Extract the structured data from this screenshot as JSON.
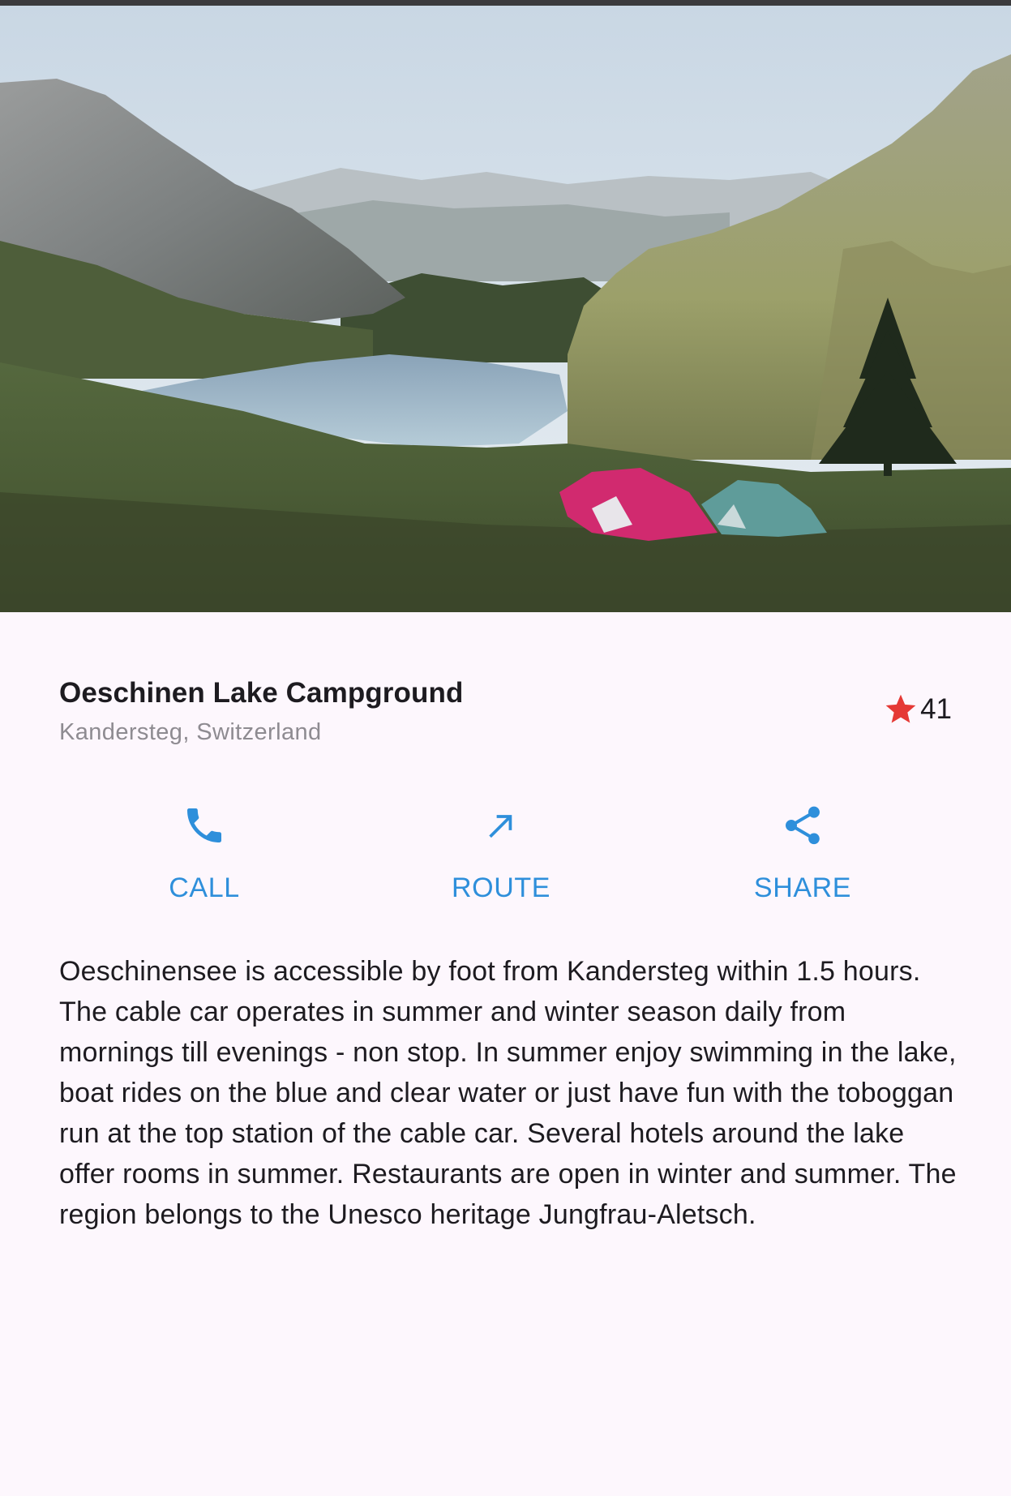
{
  "place": {
    "name": "Oeschinen Lake Campground",
    "location": "Kandersteg, Switzerland",
    "rating_count": "41",
    "star_icon": "star-icon",
    "star_color": "#e53935"
  },
  "actions": [
    {
      "label": "CALL",
      "icon": "phone-icon"
    },
    {
      "label": "ROUTE",
      "icon": "arrow-up-right-icon"
    },
    {
      "label": "SHARE",
      "icon": "share-icon"
    }
  ],
  "colors": {
    "accent": "#2e8fdb",
    "background": "#fdf7fd",
    "title": "#1d1b20",
    "subtitle": "#8e8b91"
  },
  "description": "Oeschinensee is accessible by foot from Kandersteg within 1.5 hours. The cable car operates in summer and winter season daily from mornings till evenings - non stop. In summer enjoy swimming in the lake, boat rides on the blue and clear water or just have fun with the toboggan run at the top station of the cable car. Several hotels around the lake offer rooms in summer. Restaurants are open in winter and summer. The region belongs to the Unesco heritage Jungfrau-Aletsch."
}
